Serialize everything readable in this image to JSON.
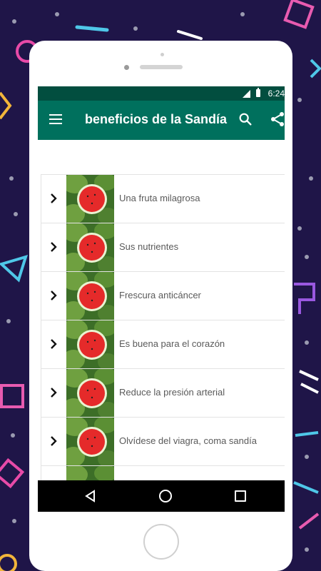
{
  "status_bar": {
    "time": "6:24"
  },
  "app_bar": {
    "title": "beneficios de la Sandía",
    "menu_icon": "hamburger-menu-icon",
    "search_icon": "search-icon",
    "share_icon": "share-icon",
    "color": "#00705d",
    "status_color": "#024e3f"
  },
  "list": {
    "items": [
      {
        "label": "Una fruta milagrosa"
      },
      {
        "label": "Sus nutrientes"
      },
      {
        "label": "Frescura anticáncer"
      },
      {
        "label": "Es buena para el corazón"
      },
      {
        "label": "Reduce la presión arterial"
      },
      {
        "label": "Olvídese del viagra, coma sandía"
      },
      {
        "label": ""
      }
    ]
  },
  "nav_bar": {
    "back_icon": "back-triangle-icon",
    "home_icon": "home-circle-icon",
    "recent_icon": "recent-apps-square-icon"
  },
  "background_color": "#1f1548"
}
